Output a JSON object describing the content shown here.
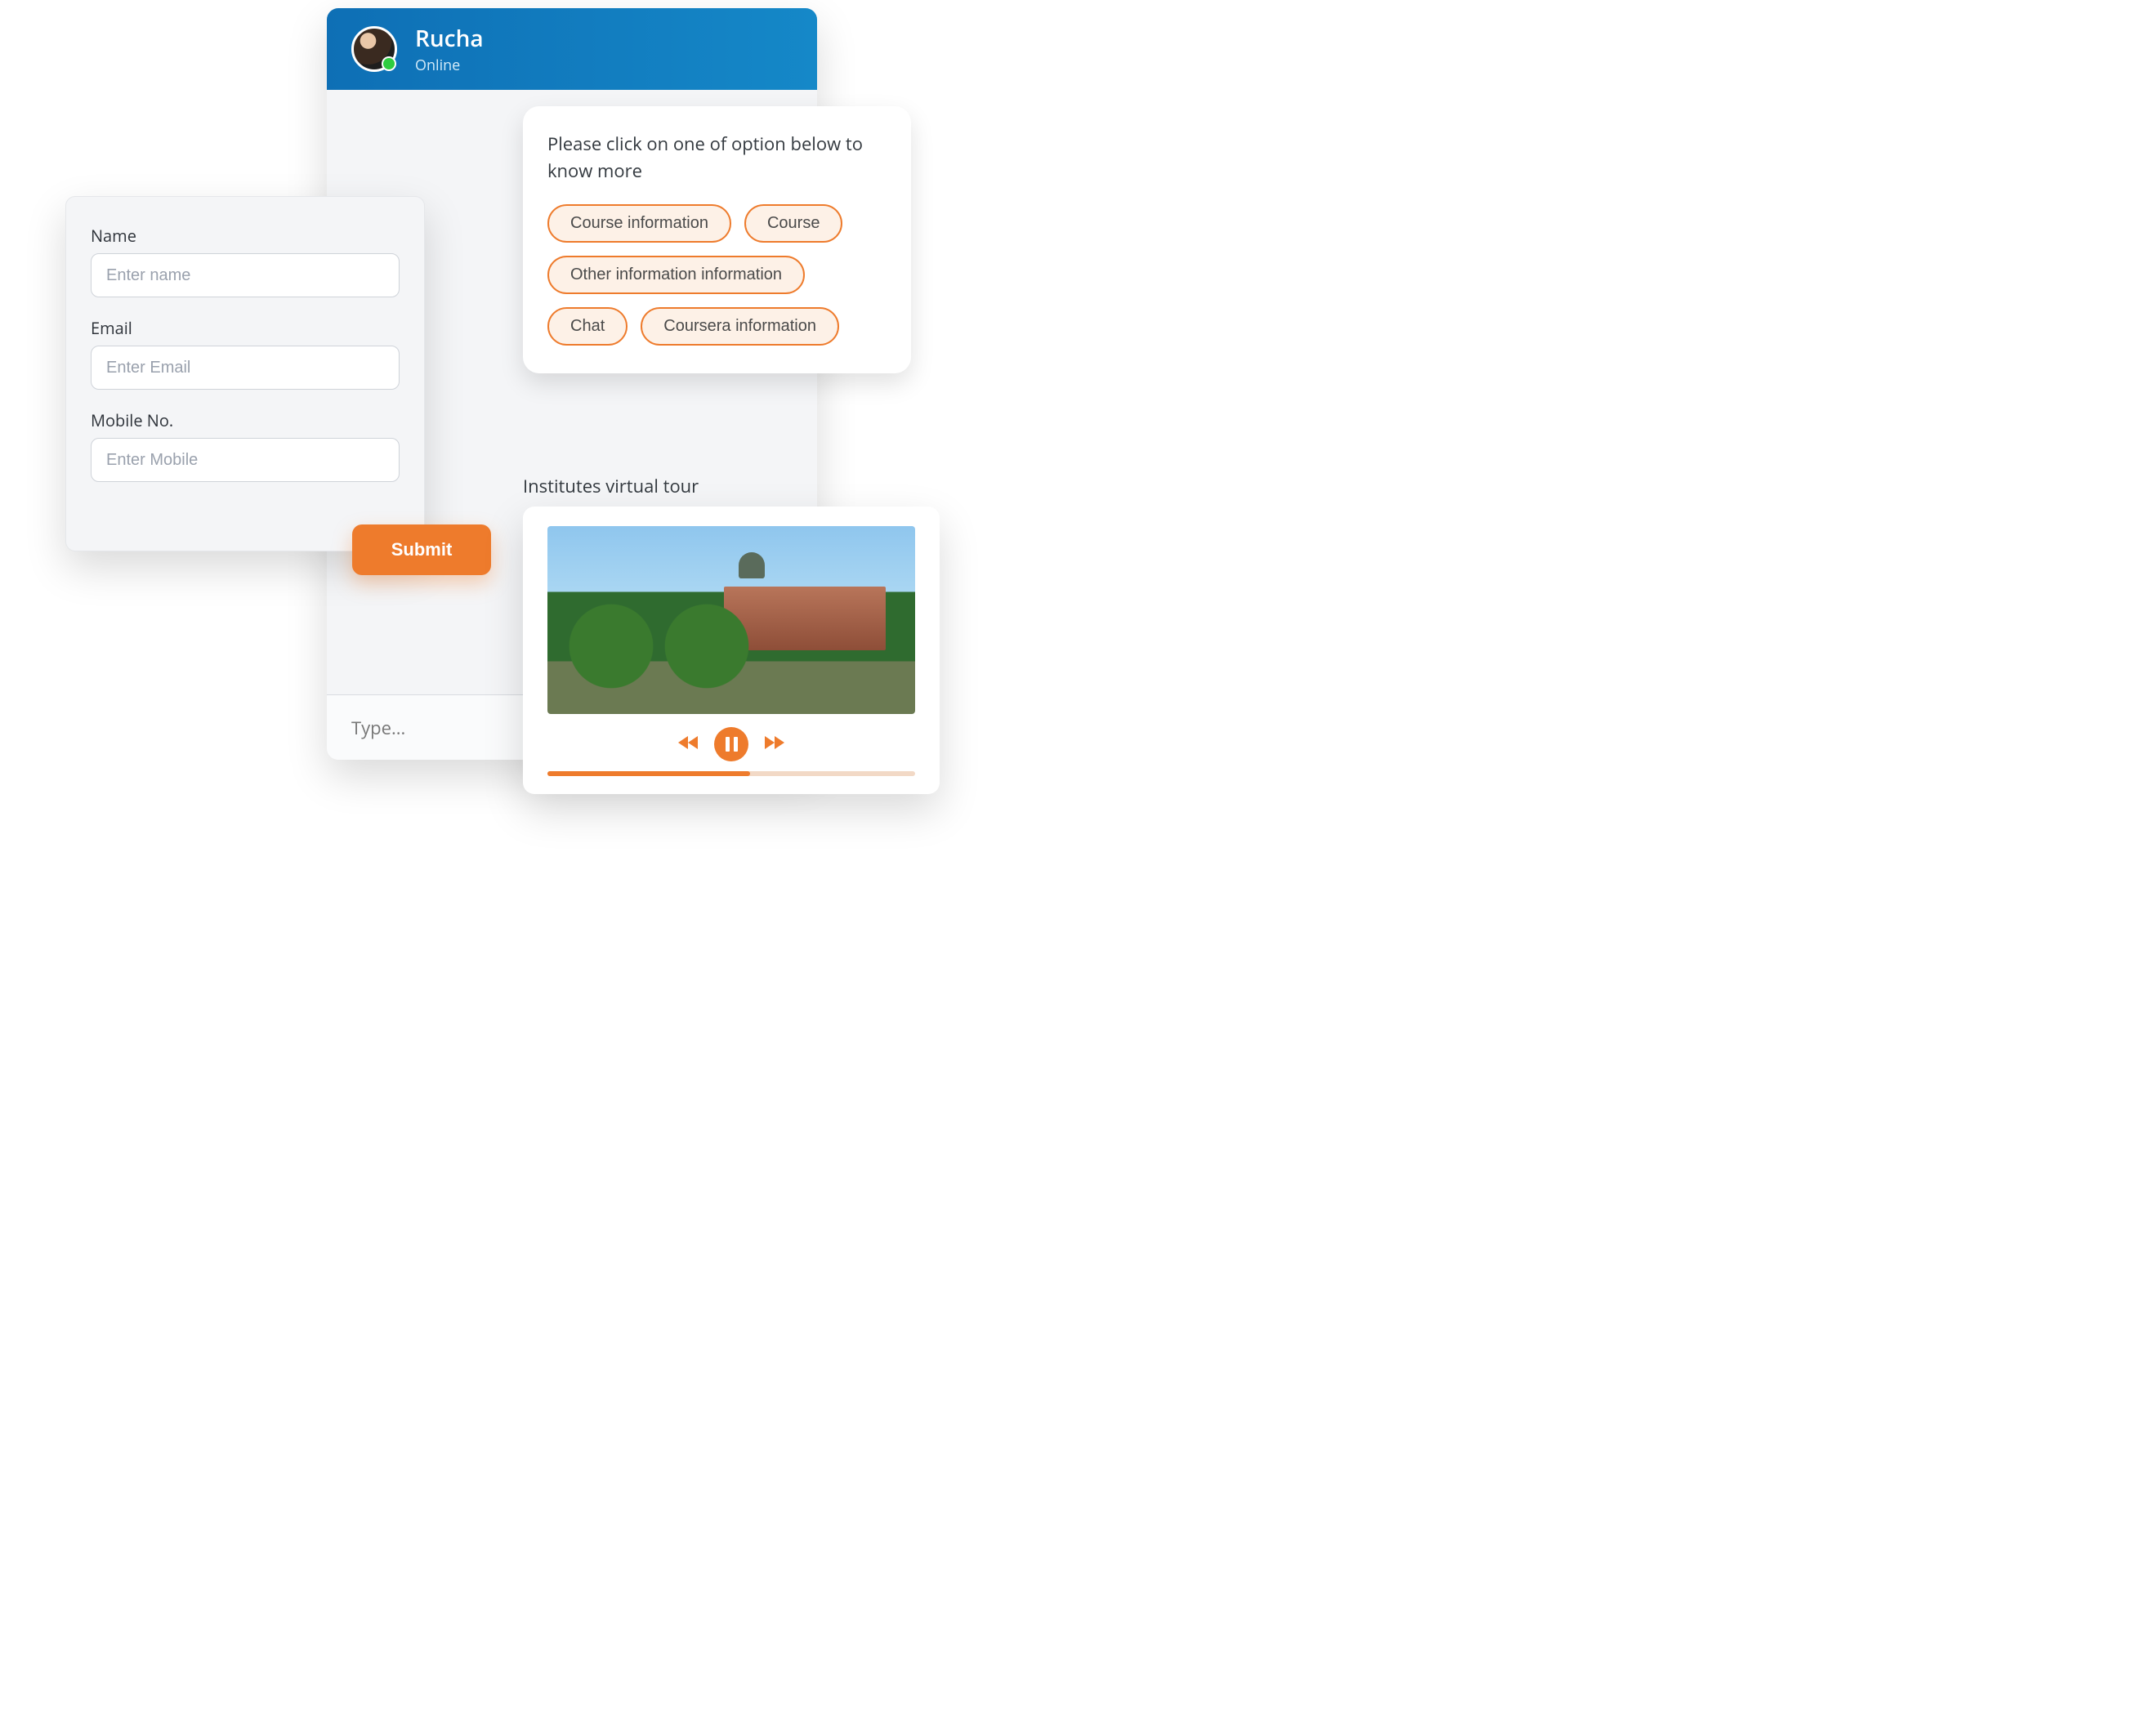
{
  "chat": {
    "name": "Rucha",
    "status": "Online",
    "input_placeholder": "Type..."
  },
  "options": {
    "prompt": "Please click on one of option below to know more",
    "chips": [
      "Course information",
      "Course",
      "Other information information",
      "Chat",
      "Coursera information"
    ]
  },
  "form": {
    "name_label": "Name",
    "name_placeholder": "Enter name",
    "email_label": "Email",
    "email_placeholder": "Enter Email",
    "mobile_label": "Mobile No.",
    "mobile_placeholder": "Enter Mobile",
    "submit_label": "Submit"
  },
  "tour": {
    "label": "Institutes virtual tour",
    "progress_percent": 55
  },
  "colors": {
    "accent": "#ee7b2c",
    "header_from": "#0e6fb5",
    "header_to": "#1588c8"
  }
}
